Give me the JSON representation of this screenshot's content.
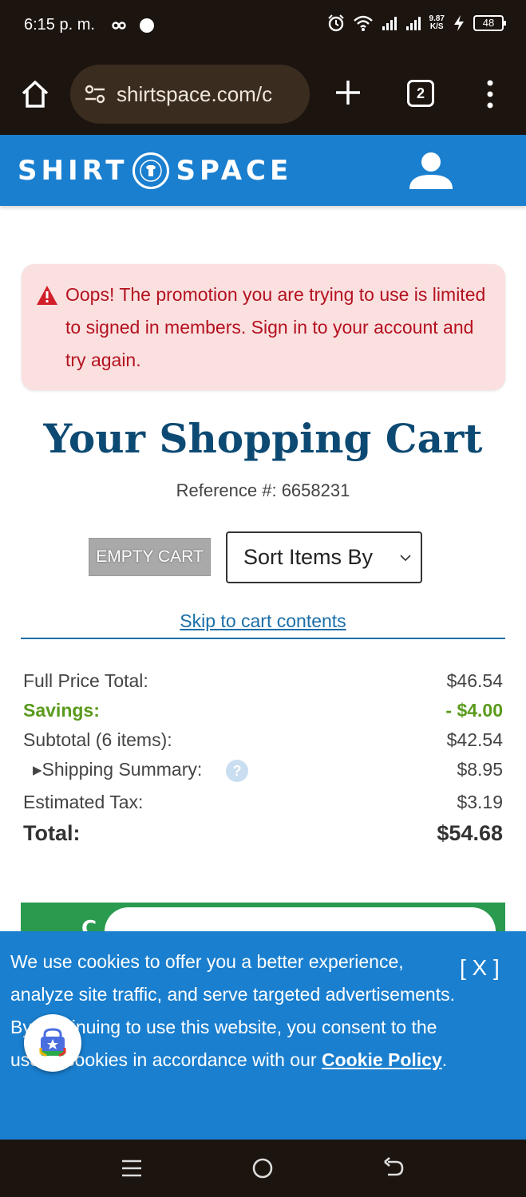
{
  "status_bar": {
    "time": "6:15 p. m.",
    "net_speed_value": "9.87",
    "net_speed_unit": "K/S",
    "battery": "48"
  },
  "browser": {
    "url": "shirtspace.com/c",
    "tab_count": "2"
  },
  "site": {
    "logo_left": "SHIRT",
    "logo_right": "SPACE",
    "brand_color": "#1a7fcf"
  },
  "alert": {
    "message": "Oops! The promotion you are trying to use is limited to signed in members. Sign in to your account and try again."
  },
  "cart": {
    "title": "Your Shopping Cart",
    "reference": "Reference #: 6658231",
    "empty_button": "EMPTY CART",
    "sort_label": "Sort Items By",
    "skip_link": "Skip to cart contents"
  },
  "summary": {
    "full_price_label": "Full Price Total:",
    "full_price_value": "$46.54",
    "savings_label": "Savings:",
    "savings_value": "- $4.00",
    "subtotal_label": "Subtotal (6 items):",
    "subtotal_value": "$42.54",
    "shipping_label": "▸Shipping Summary:",
    "shipping_value": "$8.95",
    "help_icon": "?",
    "tax_label": "Estimated Tax:",
    "tax_value": "$3.19",
    "total_label": "Total:",
    "total_value": "$54.68"
  },
  "checkout": {
    "partial_letter": "C"
  },
  "cookie": {
    "text": "We use cookies to offer you a better experience, analyze site traffic, and serve targeted advertisements. By continuing to use this website, you consent to the use of cookies in accordance with our ",
    "link": "Cookie Policy",
    "period": ".",
    "close": "[ X ]"
  }
}
